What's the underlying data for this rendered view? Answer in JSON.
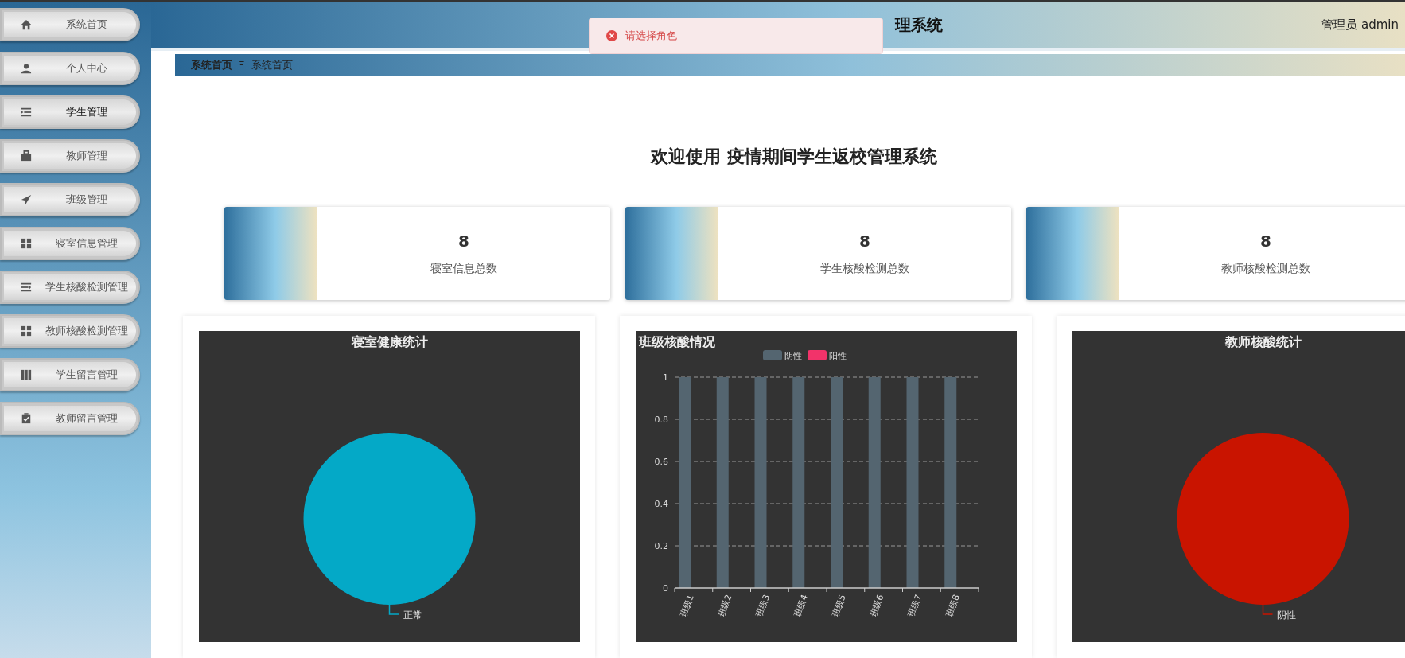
{
  "sidebar": {
    "items": [
      {
        "label": "系统首页",
        "selected": false
      },
      {
        "label": "个人中心",
        "selected": false
      },
      {
        "label": "学生管理",
        "selected": true
      },
      {
        "label": "教师管理",
        "selected": false
      },
      {
        "label": "班级管理",
        "selected": false
      },
      {
        "label": "寝室信息管理",
        "selected": false
      },
      {
        "label": "学生核酸检测管理",
        "selected": false
      },
      {
        "label": "教师核酸检测管理",
        "selected": false
      },
      {
        "label": "学生留言管理",
        "selected": false
      },
      {
        "label": "教师留言管理",
        "selected": false
      }
    ]
  },
  "header": {
    "title": "理系统",
    "user": "管理员 admin"
  },
  "toast": {
    "message": "请选择角色"
  },
  "breadcrumb": {
    "items": [
      "系统首页",
      "系统首页"
    ],
    "separator": "Ξ"
  },
  "welcome": "欢迎使用 疫情期间学生返校管理系统",
  "stats": [
    {
      "value": "8",
      "label": "寝室信息总数"
    },
    {
      "value": "8",
      "label": "学生核酸检测总数"
    },
    {
      "value": "8",
      "label": "教师核酸检测总数"
    }
  ],
  "charts": [
    {
      "chart_data": {
        "type": "pie",
        "title": "寝室健康统计",
        "categories": [
          "正常"
        ],
        "values": [
          1
        ],
        "colors": [
          "#04a9c7"
        ]
      }
    },
    {
      "chart_data": {
        "type": "bar",
        "title": "班级核酸情况",
        "categories": [
          "班级1",
          "班级2",
          "班级3",
          "班级4",
          "班级5",
          "班级6",
          "班级7",
          "班级8"
        ],
        "series": [
          {
            "name": "阴性",
            "color": "#546570",
            "values": [
              1,
              1,
              1,
              1,
              1,
              1,
              1,
              1
            ]
          },
          {
            "name": "阳性",
            "color": "#f2336a",
            "values": [
              0,
              0,
              0,
              0,
              0,
              0,
              0,
              0
            ]
          }
        ],
        "ylim": [
          0,
          1
        ],
        "yticks": [
          0,
          0.2,
          0.4,
          0.6,
          0.8,
          1
        ],
        "grid": true
      }
    },
    {
      "chart_data": {
        "type": "pie",
        "title": "教师核酸统计",
        "categories": [
          "阴性"
        ],
        "values": [
          1
        ],
        "colors": [
          "#c91400"
        ]
      }
    }
  ]
}
